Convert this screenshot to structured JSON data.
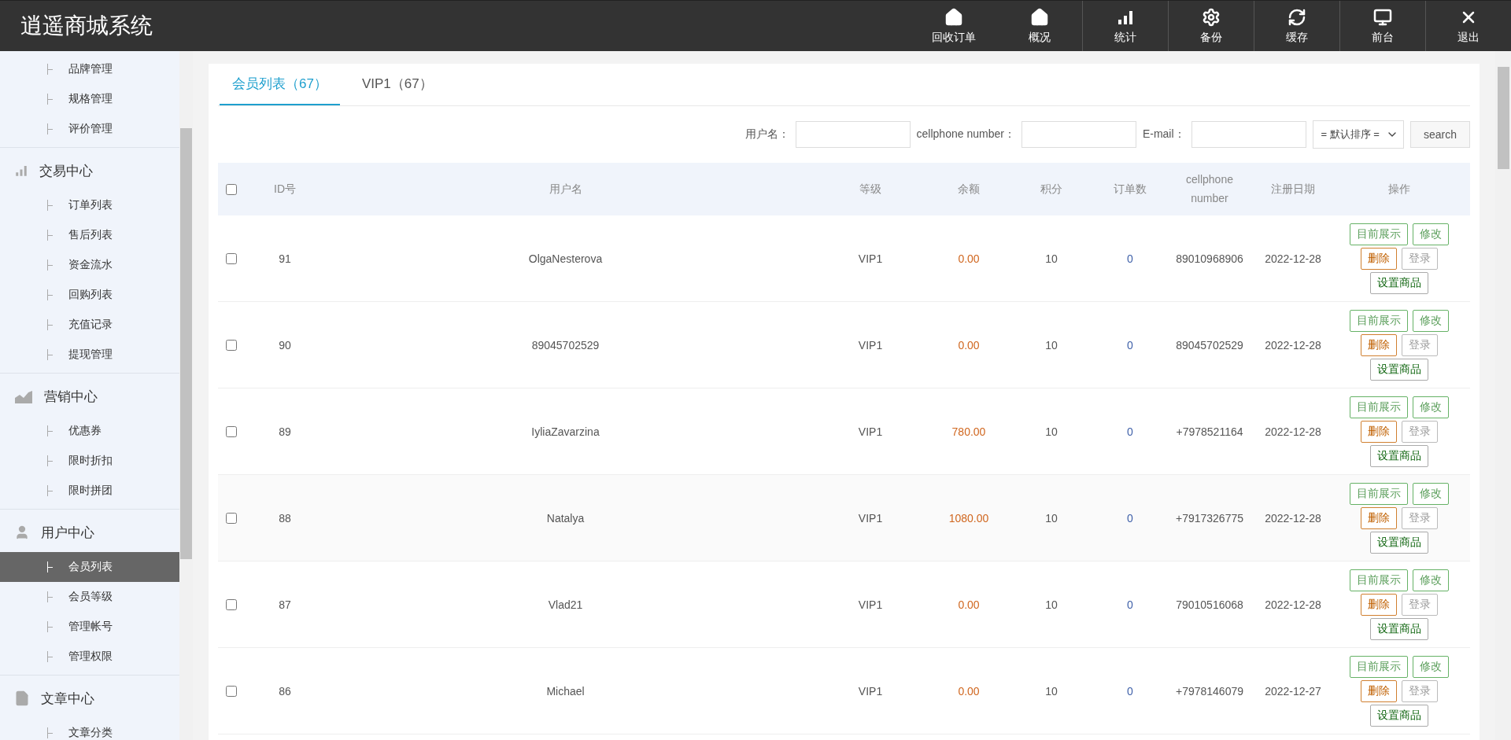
{
  "header": {
    "title": "逍遥商城系统",
    "nav": [
      {
        "label": "回收订单"
      },
      {
        "label": "概况"
      },
      {
        "label": "统计"
      },
      {
        "label": "备份"
      },
      {
        "label": "缓存"
      },
      {
        "label": "前台"
      },
      {
        "label": "退出"
      }
    ]
  },
  "sidebar": {
    "groups": [
      {
        "items": [
          {
            "label": "品牌管理",
            "selected": false
          },
          {
            "label": "规格管理",
            "selected": false
          },
          {
            "label": "评价管理",
            "selected": false
          }
        ]
      },
      {
        "title": "交易中心",
        "items": [
          {
            "label": "订单列表",
            "selected": false
          },
          {
            "label": "售后列表",
            "selected": false
          },
          {
            "label": "资金流水",
            "selected": false
          },
          {
            "label": "回购列表",
            "selected": false
          },
          {
            "label": "充值记录",
            "selected": false
          },
          {
            "label": "提现管理",
            "selected": false
          }
        ]
      },
      {
        "title": "营销中心",
        "items": [
          {
            "label": "优惠券",
            "selected": false
          },
          {
            "label": "限时折扣",
            "selected": false
          },
          {
            "label": "限时拼团",
            "selected": false
          }
        ]
      },
      {
        "title": "用户中心",
        "items": [
          {
            "label": "会员列表",
            "selected": true
          },
          {
            "label": "会员等级",
            "selected": false
          },
          {
            "label": "管理帐号",
            "selected": false
          },
          {
            "label": "管理权限",
            "selected": false
          }
        ]
      },
      {
        "title": "文章中心",
        "items": [
          {
            "label": "文章分类",
            "selected": false
          }
        ]
      }
    ]
  },
  "tabs": [
    {
      "label": "会员列表（67）",
      "selected": true
    },
    {
      "label": "VIP1（67）",
      "selected": false
    }
  ],
  "filters": {
    "fields": [
      {
        "label": "用户名："
      },
      {
        "label": "cellphone number："
      },
      {
        "label": "E-mail："
      }
    ],
    "sort": "= 默认排序 =",
    "search": "search"
  },
  "table": {
    "header_checked": false,
    "columns": [
      "ID号",
      "用户名",
      "等级",
      "余额",
      "积分",
      "订单数",
      "cellphone number",
      "注册日期",
      "操作"
    ],
    "rows": [
      {
        "checked": false,
        "cells": [
          "91",
          "OlgaNesterova",
          "VIP1",
          "0.00",
          "10",
          "0",
          "89010968906",
          "2022-12-28"
        ],
        "actions": [
          {
            "label": "目前展示",
            "kind": "show"
          },
          {
            "label": "修改",
            "kind": "edit"
          },
          {
            "label": "删除",
            "kind": "delete"
          },
          {
            "label": "登录",
            "kind": "login"
          },
          {
            "label": "设置商品",
            "kind": "goods"
          }
        ]
      },
      {
        "checked": false,
        "cells": [
          "90",
          "89045702529",
          "VIP1",
          "0.00",
          "10",
          "0",
          "89045702529",
          "2022-12-28"
        ],
        "actions": [
          {
            "label": "目前展示",
            "kind": "show"
          },
          {
            "label": "修改",
            "kind": "edit"
          },
          {
            "label": "删除",
            "kind": "delete"
          },
          {
            "label": "登录",
            "kind": "login"
          },
          {
            "label": "设置商品",
            "kind": "goods"
          }
        ]
      },
      {
        "checked": false,
        "cells": [
          "89",
          "IyliaZavarzina",
          "VIP1",
          "780.00",
          "10",
          "0",
          "+7978521164",
          "2022-12-28"
        ],
        "actions": [
          {
            "label": "目前展示",
            "kind": "show"
          },
          {
            "label": "修改",
            "kind": "edit"
          },
          {
            "label": "删除",
            "kind": "delete"
          },
          {
            "label": "登录",
            "kind": "login"
          },
          {
            "label": "设置商品",
            "kind": "goods"
          }
        ]
      },
      {
        "checked": false,
        "cells": [
          "88",
          "Natalya",
          "VIP1",
          "1080.00",
          "10",
          "0",
          "+7917326775",
          "2022-12-28"
        ],
        "actions": [
          {
            "label": "目前展示",
            "kind": "show"
          },
          {
            "label": "修改",
            "kind": "edit"
          },
          {
            "label": "删除",
            "kind": "delete"
          },
          {
            "label": "登录",
            "kind": "login"
          },
          {
            "label": "设置商品",
            "kind": "goods"
          }
        ]
      },
      {
        "checked": false,
        "cells": [
          "87",
          "Vlad21",
          "VIP1",
          "0.00",
          "10",
          "0",
          "79010516068",
          "2022-12-28"
        ],
        "actions": [
          {
            "label": "目前展示",
            "kind": "show"
          },
          {
            "label": "修改",
            "kind": "edit"
          },
          {
            "label": "删除",
            "kind": "delete"
          },
          {
            "label": "登录",
            "kind": "login"
          },
          {
            "label": "设置商品",
            "kind": "goods"
          }
        ]
      },
      {
        "checked": false,
        "cells": [
          "86",
          "Michael",
          "VIP1",
          "0.00",
          "10",
          "0",
          "+7978146079",
          "2022-12-27"
        ],
        "actions": [
          {
            "label": "目前展示",
            "kind": "show"
          },
          {
            "label": "修改",
            "kind": "edit"
          },
          {
            "label": "删除",
            "kind": "delete"
          },
          {
            "label": "登录",
            "kind": "login"
          },
          {
            "label": "设置商品",
            "kind": "goods"
          }
        ]
      }
    ]
  }
}
